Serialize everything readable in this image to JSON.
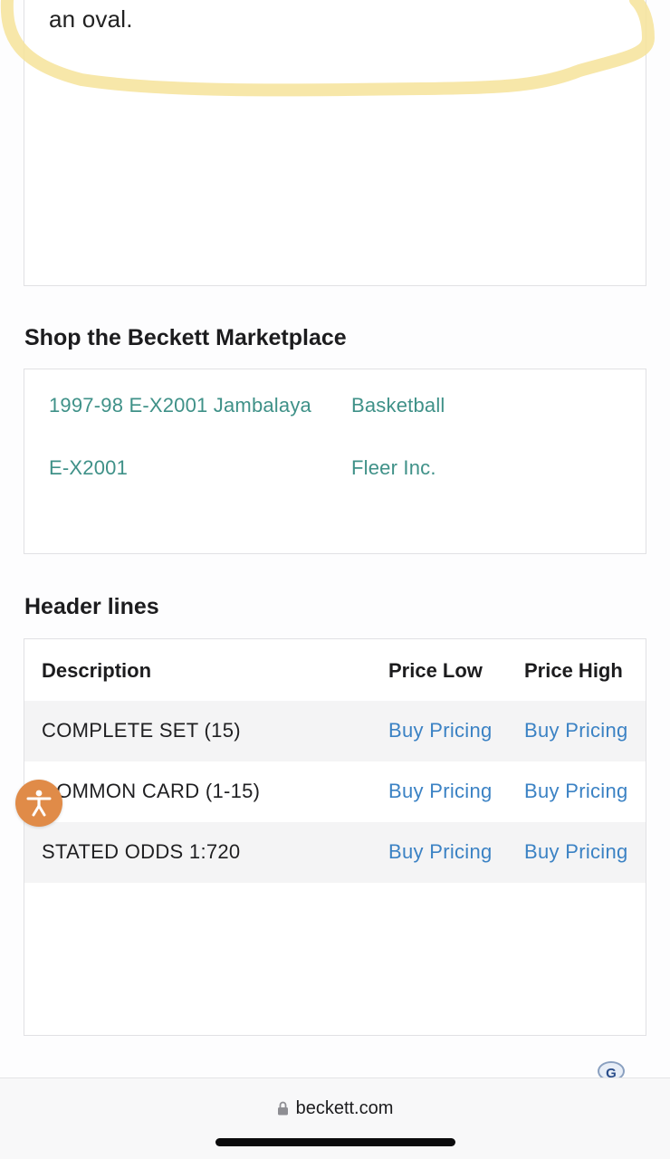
{
  "description_card": {
    "text_tail": "an oval."
  },
  "marketplace": {
    "title": "Shop the Beckett Marketplace",
    "links": [
      "1997-98 E-X2001 Jambalaya",
      "Basketball",
      "E-X2001",
      "Fleer Inc."
    ]
  },
  "header_lines": {
    "title": "Header lines",
    "columns": [
      "Description",
      "Price Low",
      "Price High"
    ],
    "rows": [
      {
        "description": "COMPLETE SET (15)",
        "price_low": "Buy Pricing",
        "price_high": "Buy Pricing"
      },
      {
        "description": "COMMON CARD (1-15)",
        "price_low": "Buy Pricing",
        "price_high": "Buy Pricing"
      },
      {
        "description": "STATED ODDS 1:720",
        "price_low": "Buy Pricing",
        "price_high": "Buy Pricing"
      }
    ]
  },
  "badge": {
    "letter": "G"
  },
  "browser": {
    "url": "beckett.com"
  },
  "colors": {
    "marketplace_link": "#3f9188",
    "pricing_link": "#3b82c4",
    "accessibility_button": "#e08b48",
    "highlight": "#f6e39a"
  },
  "icons": [
    "accessibility-icon",
    "lock-icon",
    "g-badge-icon"
  ]
}
